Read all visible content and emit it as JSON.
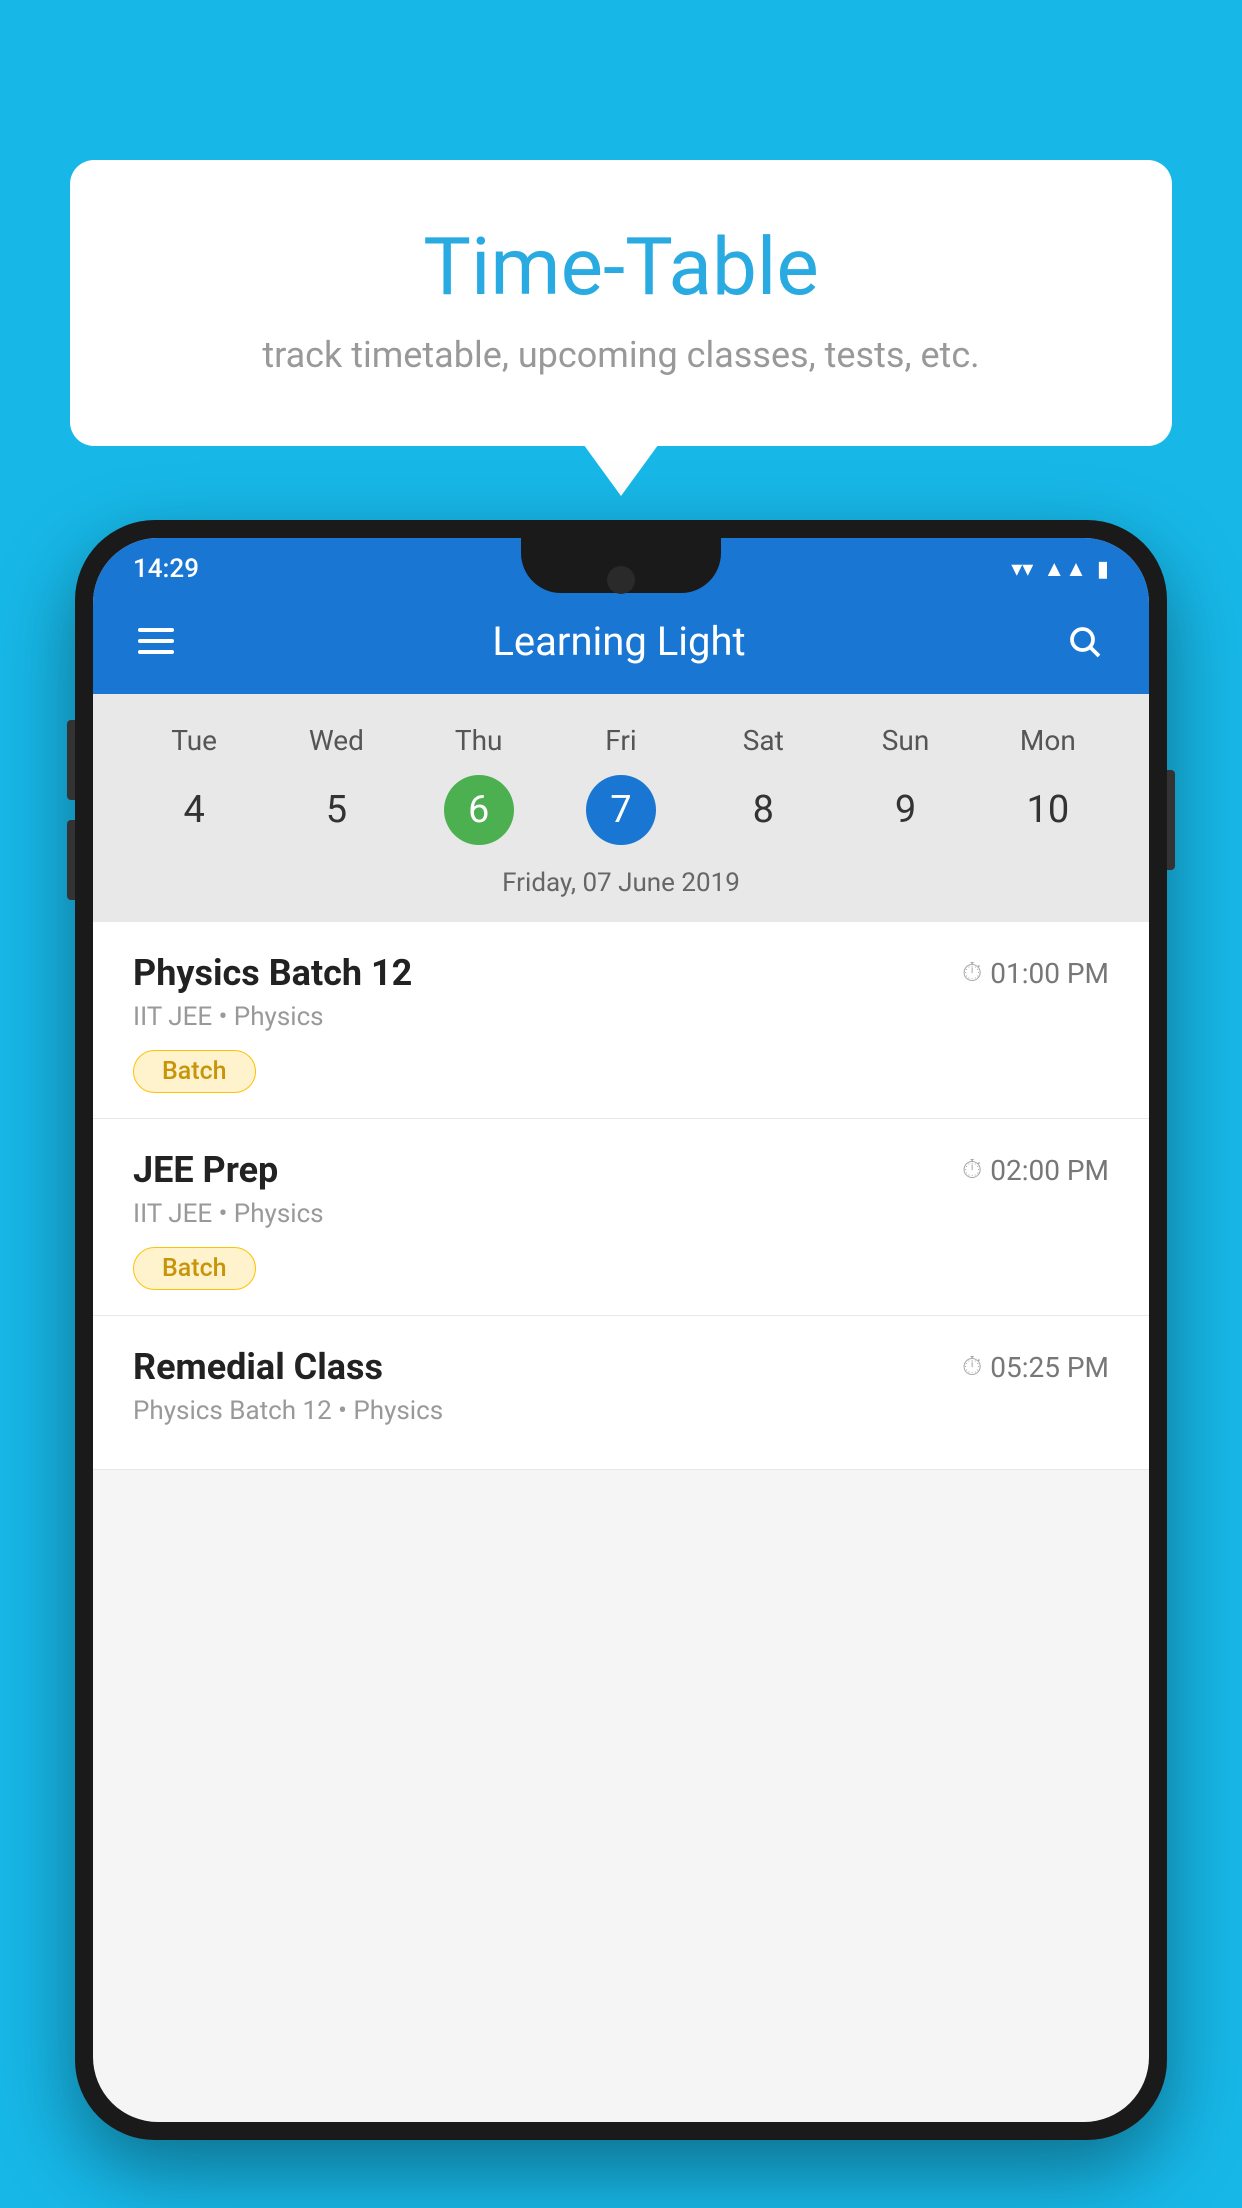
{
  "background_color": "#17b8e8",
  "bubble": {
    "title": "Time-Table",
    "subtitle": "track timetable, upcoming classes, tests, etc."
  },
  "phone": {
    "status_bar": {
      "time": "14:29"
    },
    "app_header": {
      "title": "Learning Light"
    },
    "calendar": {
      "days": [
        {
          "name": "Tue",
          "num": "4",
          "state": "normal"
        },
        {
          "name": "Wed",
          "num": "5",
          "state": "normal"
        },
        {
          "name": "Thu",
          "num": "6",
          "state": "today"
        },
        {
          "name": "Fri",
          "num": "7",
          "state": "selected"
        },
        {
          "name": "Sat",
          "num": "8",
          "state": "normal"
        },
        {
          "name": "Sun",
          "num": "9",
          "state": "normal"
        },
        {
          "name": "Mon",
          "num": "10",
          "state": "normal"
        }
      ],
      "selected_date_label": "Friday, 07 June 2019"
    },
    "classes": [
      {
        "name": "Physics Batch 12",
        "time": "01:00 PM",
        "details": "IIT JEE • Physics",
        "tag": "Batch"
      },
      {
        "name": "JEE Prep",
        "time": "02:00 PM",
        "details": "IIT JEE • Physics",
        "tag": "Batch"
      },
      {
        "name": "Remedial Class",
        "time": "05:25 PM",
        "details": "Physics Batch 12 • Physics",
        "tag": ""
      }
    ]
  }
}
